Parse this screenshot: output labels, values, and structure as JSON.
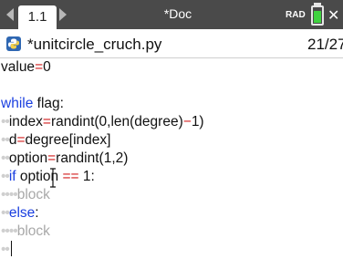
{
  "topbar": {
    "tab_label": "1.1",
    "doc_title": "*Doc",
    "mode": "RAD",
    "close_label": "✕",
    "battery_color": "#3fd23f"
  },
  "file": {
    "name": "*unitcircle_cruch.py",
    "line_info": "21/27",
    "icon": "python-icon"
  },
  "code": {
    "l0": {
      "a": "value",
      "b": "=",
      "c": "0"
    },
    "l2": {
      "kw": "while",
      "rest": " flag:"
    },
    "l3": {
      "dots": "••",
      "a": "index",
      "b": "=",
      "c": "randint(0,len(degree)",
      "d": "−",
      "e": "1)"
    },
    "l4": {
      "dots": "••",
      "a": "d",
      "b": "=",
      "c": "degree[index]"
    },
    "l5": {
      "dots": "••",
      "a": "option",
      "b": "=",
      "c": "randint(1,2)"
    },
    "l6": {
      "dots": "••",
      "kw": "if",
      "a": " option ",
      "b": "==",
      "c": " 1:"
    },
    "l7": {
      "dots": "••••",
      "ph": "block"
    },
    "l8": {
      "dots": "••",
      "kw": "else",
      "rest": ":"
    },
    "l9": {
      "dots": "••••",
      "ph": "block"
    },
    "l10": {
      "dots": "••"
    }
  },
  "colors": {
    "keyword": "#1a3fe0",
    "operator": "#d21d1d",
    "placeholder": "#a8a8a8",
    "indent_dots": "#cfcfcf"
  }
}
